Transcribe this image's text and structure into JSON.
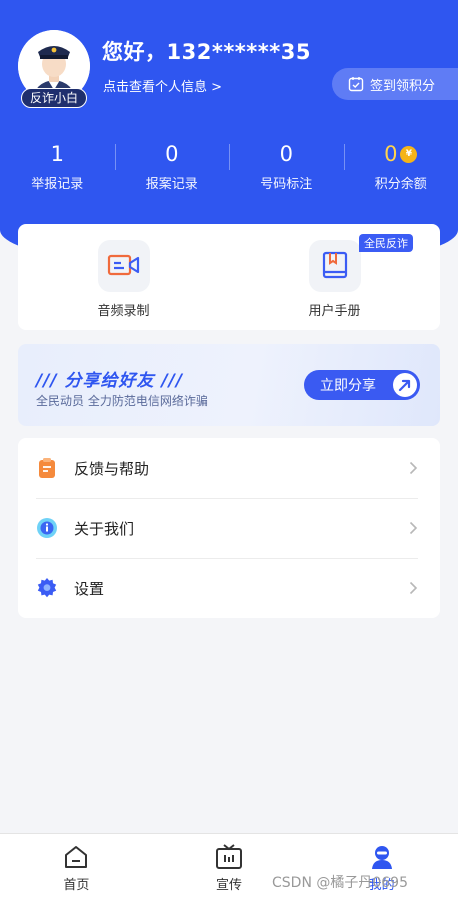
{
  "header": {
    "greeting": "您好，132******35",
    "profile_link": "点击查看个人信息 >",
    "avatar_badge": "反诈小白",
    "checkin_label": "签到领积分"
  },
  "stats": [
    {
      "value": "1",
      "label": "举报记录"
    },
    {
      "value": "0",
      "label": "报案记录"
    },
    {
      "value": "0",
      "label": "号码标注"
    },
    {
      "value": "0",
      "label": "积分余额"
    }
  ],
  "tools": {
    "audio_label": "音频录制",
    "manual_label": "用户手册",
    "manual_tag": "全民反诈"
  },
  "share": {
    "title": "/// 分享给好友 ///",
    "subtitle": "全民动员 全力防范电信网络诈骗",
    "button_label": "立即分享"
  },
  "menu": [
    {
      "label": "反馈与帮助",
      "icon": "clipboard-icon"
    },
    {
      "label": "关于我们",
      "icon": "info-icon"
    },
    {
      "label": "设置",
      "icon": "gear-icon"
    }
  ],
  "tabbar": [
    {
      "label": "首页",
      "icon": "home-icon"
    },
    {
      "label": "宣传",
      "icon": "tv-icon"
    },
    {
      "label": "我的",
      "icon": "user-icon",
      "active": true
    }
  ],
  "watermark": "CSDN @橘子丹0695",
  "colors": {
    "primary": "#2f56f0",
    "gold": "#ffd44d"
  }
}
